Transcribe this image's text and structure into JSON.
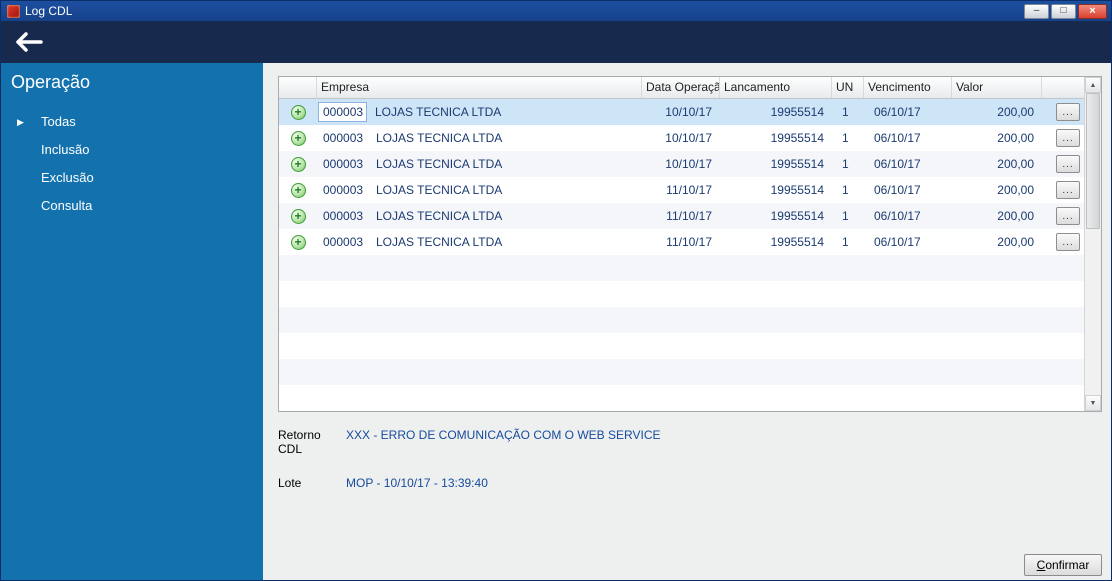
{
  "window": {
    "title": "Log CDL",
    "minimize_icon": "–",
    "maximize_icon": "□",
    "close_icon": "×"
  },
  "sidebar": {
    "title": "Operação",
    "active_marker": "▶",
    "items": [
      {
        "label": "Todas",
        "active": true
      },
      {
        "label": "Inclusão",
        "active": false
      },
      {
        "label": "Exclusão",
        "active": false
      },
      {
        "label": "Consulta",
        "active": false
      }
    ]
  },
  "table": {
    "columns": [
      "Empresa",
      "Data Operação",
      "Lancamento",
      "UN",
      "Vencimento",
      "Valor"
    ],
    "add_icon": "+",
    "row_action_label": "...",
    "scroll_up_icon": "▲",
    "scroll_down_icon": "▼",
    "rows": [
      {
        "empresa_code": "000003",
        "empresa_name": "LOJAS  TECNICA LTDA",
        "data_operacao": "10/10/17",
        "lancamento": "19955514",
        "un": "1",
        "vencimento": "06/10/17",
        "valor": "200,00",
        "selected": true
      },
      {
        "empresa_code": "000003",
        "empresa_name": "LOJAS  TECNICA LTDA",
        "data_operacao": "10/10/17",
        "lancamento": "19955514",
        "un": "1",
        "vencimento": "06/10/17",
        "valor": "200,00",
        "selected": false
      },
      {
        "empresa_code": "000003",
        "empresa_name": "LOJAS  TECNICA LTDA",
        "data_operacao": "10/10/17",
        "lancamento": "19955514",
        "un": "1",
        "vencimento": "06/10/17",
        "valor": "200,00",
        "selected": false
      },
      {
        "empresa_code": "000003",
        "empresa_name": "LOJAS  TECNICA LTDA",
        "data_operacao": "11/10/17",
        "lancamento": "19955514",
        "un": "1",
        "vencimento": "06/10/17",
        "valor": "200,00",
        "selected": false
      },
      {
        "empresa_code": "000003",
        "empresa_name": "LOJAS  TECNICA LTDA",
        "data_operacao": "11/10/17",
        "lancamento": "19955514",
        "un": "1",
        "vencimento": "06/10/17",
        "valor": "200,00",
        "selected": false
      },
      {
        "empresa_code": "000003",
        "empresa_name": "LOJAS  TECNICA LTDA",
        "data_operacao": "11/10/17",
        "lancamento": "19955514",
        "un": "1",
        "vencimento": "06/10/17",
        "valor": "200,00",
        "selected": false
      }
    ]
  },
  "details": {
    "retorno_label": "Retorno CDL",
    "retorno_value": "XXX - ERRO DE COMUNICAÇÃO COM O WEB SERVICE",
    "lote_label": "Lote",
    "lote_value": "MOP - 10/10/17 - 13:39:40"
  },
  "footer": {
    "confirm_accel": "C",
    "confirm_rest": "onfirmar"
  },
  "colors": {
    "titlebar": "#1d4fa0",
    "header_bar": "#172a4e",
    "sidebar": "#1371ae",
    "selected_row": "#cde5f7",
    "grid_text": "#1b3a70",
    "detail_value": "#164a9e",
    "add_green": "#3f9e3a",
    "close_red": "#d9402f"
  }
}
